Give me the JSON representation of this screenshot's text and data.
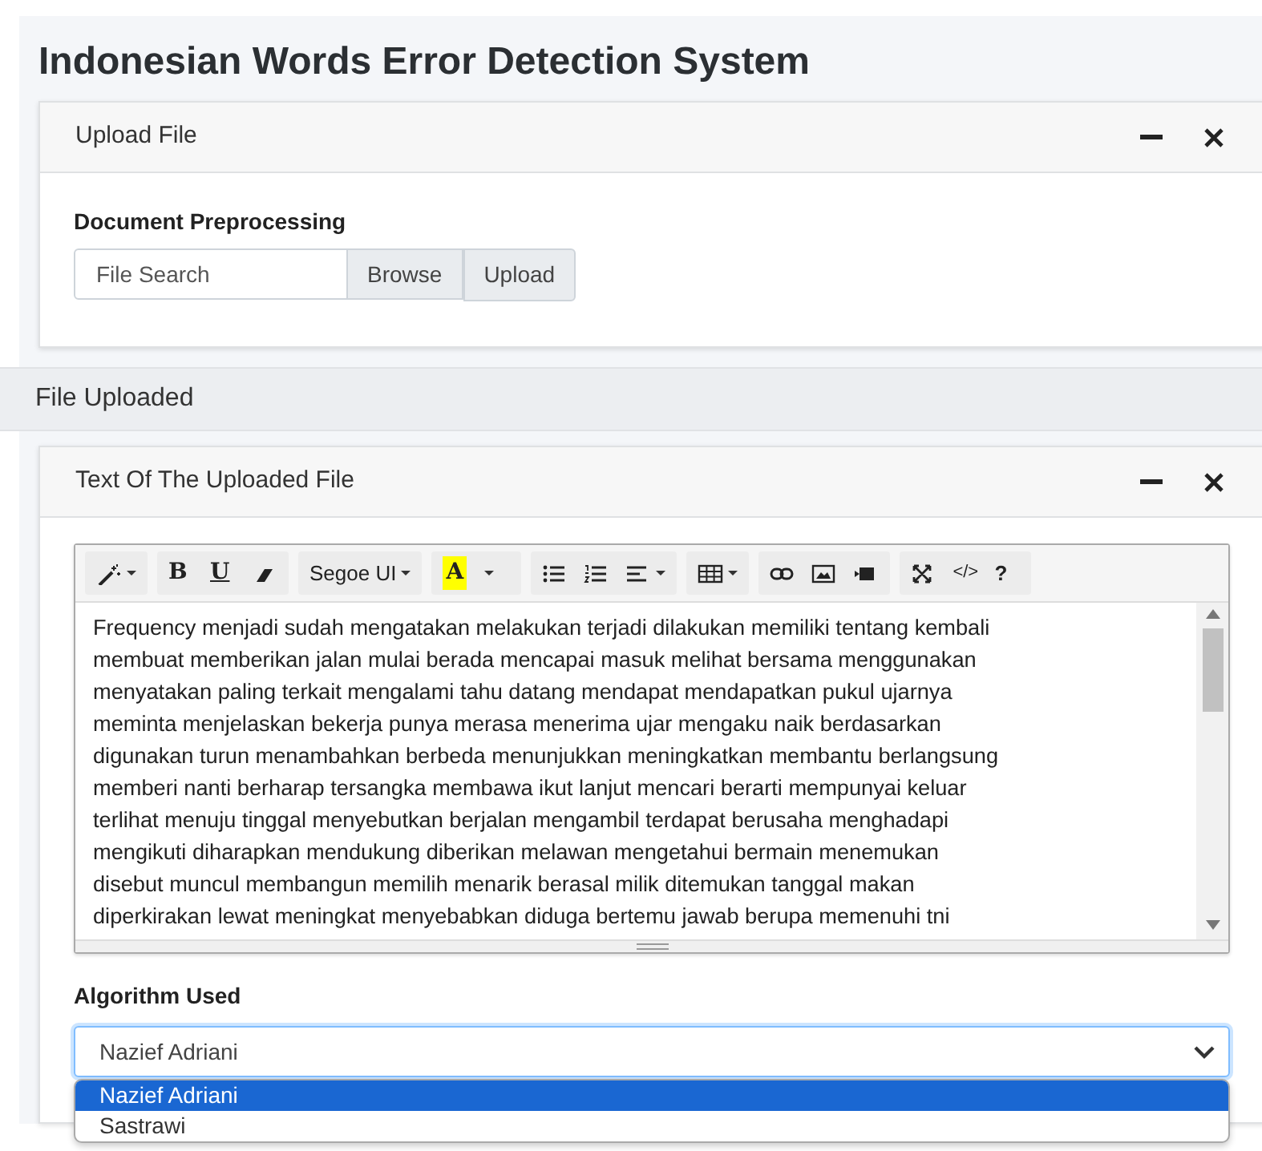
{
  "page_title": "Indonesian Words Error Detection System",
  "upload_card": {
    "title": "Upload File",
    "section_label": "Document Preprocessing",
    "file_field": {
      "placeholder": "File Search"
    },
    "browse_label": "Browse",
    "upload_button": "Upload"
  },
  "section_bar": "File Uploaded",
  "text_card": {
    "title": "Text Of The Uploaded File",
    "toolbar": [
      [
        {
          "kind": "wand",
          "caret": true
        }
      ],
      [
        {
          "kind": "bold",
          "label": "B",
          "caret": false
        },
        {
          "kind": "underline",
          "label": "U",
          "caret": false
        },
        {
          "kind": "eraser",
          "caret": false
        }
      ],
      [
        {
          "kind": "font",
          "label": "Segoe UI",
          "caret": true
        }
      ],
      [
        {
          "kind": "highlight",
          "label": "A",
          "caret": false
        },
        {
          "kind": "caret",
          "caret": true
        }
      ],
      [
        {
          "kind": "bullets",
          "caret": false
        },
        {
          "kind": "numbers",
          "caret": false
        },
        {
          "kind": "align",
          "caret": true
        }
      ],
      [
        {
          "kind": "table",
          "caret": true
        }
      ],
      [
        {
          "kind": "link",
          "caret": false
        },
        {
          "kind": "image",
          "caret": false
        },
        {
          "kind": "video",
          "caret": false
        }
      ],
      [
        {
          "kind": "fullscreen",
          "caret": false
        },
        {
          "kind": "code",
          "label": "</>",
          "caret": false
        },
        {
          "kind": "help",
          "label": "?",
          "caret": false
        }
      ]
    ],
    "text_lines": [
      "Frequency menjadi sudah mengatakan melakukan terjadi dilakukan memiliki tentang kembali",
      "membuat memberikan jalan mulai berada mencapai masuk melihat bersama menggunakan",
      "menyatakan paling terkait mengalami tahu datang mendapat mendapatkan pukul ujarnya",
      "meminta menjelaskan bekerja punya merasa menerima ujar mengaku naik berdasarkan",
      "digunakan turun menambahkan berbeda menunjukkan meningkatkan membantu berlangsung",
      "memberi nanti berharap tersangka membawa ikut lanjut mencari berarti mempunyai keluar",
      "terlihat menuju tinggal menyebutkan berjalan mengambil terdapat berusaha menghadapi",
      "mengikuti diharapkan mendukung diberikan melawan mengetahui bermain menemukan",
      "disebut muncul membangun memilih menarik berasal milik ditemukan tanggal makan",
      "diperkirakan lewat meningkat menyebabkan diduga bertemu jawab berupa memenuhi tni"
    ],
    "algorithm_label": "Algorithm Used",
    "algorithm_select": {
      "value": "Nazief Adriani",
      "expanded": true,
      "options": [
        {
          "label": "Nazief Adriani",
          "selected": true
        },
        {
          "label": "Sastrawi",
          "selected": false
        }
      ]
    }
  }
}
